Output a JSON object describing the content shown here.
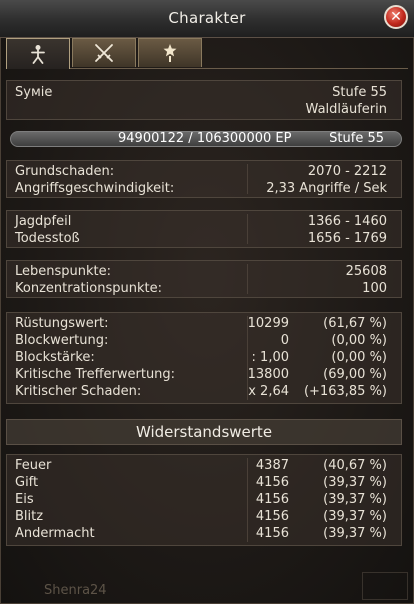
{
  "window": {
    "title": "Charakter",
    "close_glyph": "✕"
  },
  "tabs": [
    {
      "name": "character-figure-icon"
    },
    {
      "name": "crossed-swords-icon"
    },
    {
      "name": "rank-medal-icon"
    }
  ],
  "profile": {
    "name": "Sуміе",
    "level": "Stufe  55",
    "class": "Waldläuferin"
  },
  "experience": {
    "value": "94900122  /  106300000  EP",
    "level": "Stufe  55",
    "progress": 0.893
  },
  "damage": [
    {
      "label": "Grundschaden:",
      "value": "2070  -  2212"
    },
    {
      "label": "Angriffsgeschwindigkeit:",
      "value": "2,33  Angriffe  /  Sek"
    }
  ],
  "skills": [
    {
      "label": "Jagdpfeil",
      "value": "1366  -  1460"
    },
    {
      "label": "Todesstoß",
      "value": "1656  -  1769"
    }
  ],
  "vitals": [
    {
      "label": "Lebenspunkte:",
      "value": "25608"
    },
    {
      "label": "Konzentrationspunkte:",
      "value": "100"
    }
  ],
  "defense": [
    {
      "label": "Rüstungswert:",
      "value": "10299",
      "pct": "(61,67  %)"
    },
    {
      "label": "Blockwertung:",
      "value": "0",
      "pct": "(0,00  %)"
    },
    {
      "label": "Blockstärke:",
      "value": ":  1,00",
      "pct": "(0,00  %)"
    },
    {
      "label": "Kritische  Trefferwertung:",
      "value": "13800",
      "pct": "(69,00  %)"
    },
    {
      "label": "Kritischer  Schaden:",
      "value": "x  2,64",
      "pct": "(+163,85  %)"
    }
  ],
  "resistances": {
    "header": "Widerstandswerte",
    "items": [
      {
        "label": "Feuer",
        "value": "4387",
        "pct": "(40,67  %)"
      },
      {
        "label": "Gift",
        "value": "4156",
        "pct": "(39,37  %)"
      },
      {
        "label": "Eis",
        "value": "4156",
        "pct": "(39,37  %)"
      },
      {
        "label": "Blitz",
        "value": "4156",
        "pct": "(39,37  %)"
      },
      {
        "label": "Andermacht",
        "value": "4156",
        "pct": "(39,37  %)"
      }
    ]
  },
  "watermark": "Shenra24"
}
